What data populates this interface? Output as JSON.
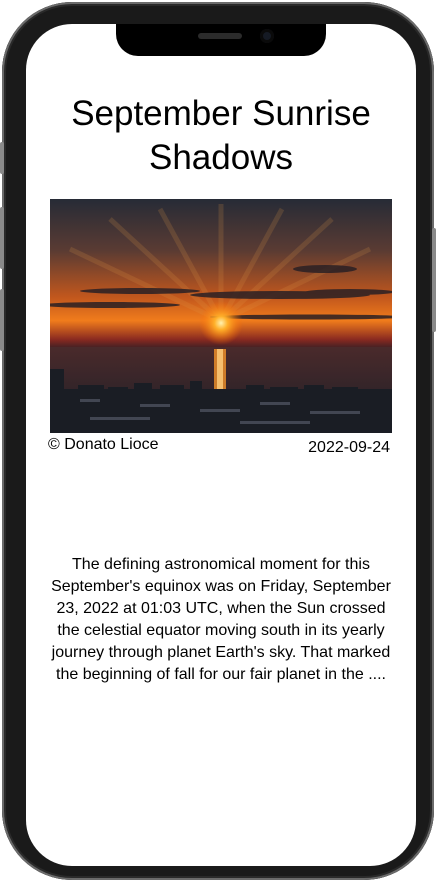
{
  "apod": {
    "title": "September Sunrise Shadows",
    "credit": "© Donato Lioce",
    "date": "2022-09-24",
    "description": "The defining astronomical moment for this September's equinox was on Friday, September 23, 2022 at 01:03 UTC, when the Sun crossed the celestial equator moving south in its yearly journey through planet Earth's sky. That marked the beginning of fall for our fair planet in the ...."
  },
  "colors": {
    "sky_top": "#2a2f3a",
    "sun_glow": "#ff8a1a",
    "sea": "#3a2a2a"
  }
}
